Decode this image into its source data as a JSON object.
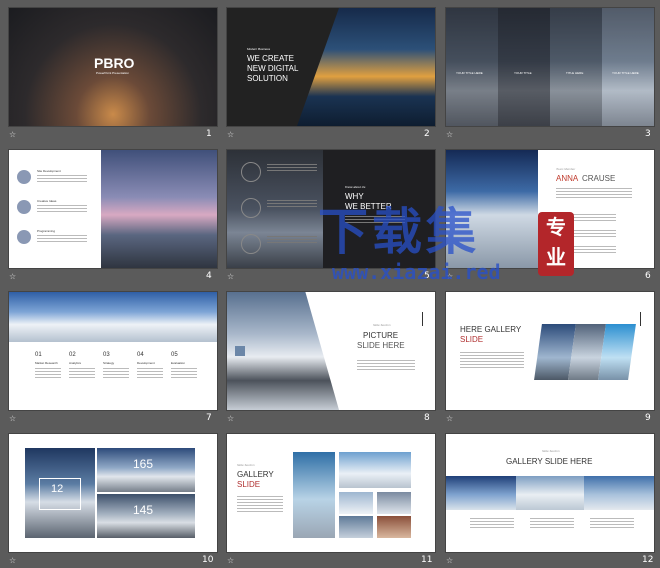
{
  "slides": [
    {
      "num": "1",
      "title": "PBRO",
      "sub": "PowerPoint  Presentation"
    },
    {
      "num": "2",
      "kicker": "Modern Business",
      "l1": "WE CREATE",
      "l2": "NEW DIGITAL",
      "l3": "SOLUTION"
    },
    {
      "num": "3",
      "labels": [
        "YOUR TITLE HERE",
        "YOUR TITLE",
        "TITLE HERE",
        "YOUR TITLE HERE"
      ]
    },
    {
      "num": "4",
      "items": [
        "Site Development",
        "Creative Ideas",
        "Programming"
      ]
    },
    {
      "num": "5",
      "kicker": "Know about Us",
      "l1": "WHY",
      "l2": "WE BETTER"
    },
    {
      "num": "6",
      "kicker": "Team Member",
      "first": "ANNA",
      "last": "CRAUSE"
    },
    {
      "num": "7",
      "steps": [
        "01",
        "02",
        "03",
        "04",
        "05"
      ],
      "labels": [
        "Market Research",
        "Analytics",
        "Strategy",
        "Development",
        "Evaluation"
      ]
    },
    {
      "num": "8",
      "kicker": "Slide Section",
      "l1": "PICTURE",
      "l2": "SLIDE HERE"
    },
    {
      "num": "9",
      "l1": "HERE GALLERY",
      "l2": "SLIDE"
    },
    {
      "num": "10",
      "big1": "12",
      "big2": "165",
      "big3": "145"
    },
    {
      "num": "11",
      "kicker": "Slide Section",
      "l1": "GALLERY",
      "l2": "SLIDE"
    },
    {
      "num": "12",
      "kicker": "Slide Section",
      "title": "GALLERY  SLIDE HERE"
    }
  ],
  "watermark": {
    "main": "下载集",
    "url": "www.xiazai.red",
    "seal": "专业"
  },
  "icons": {
    "star": "☆"
  }
}
